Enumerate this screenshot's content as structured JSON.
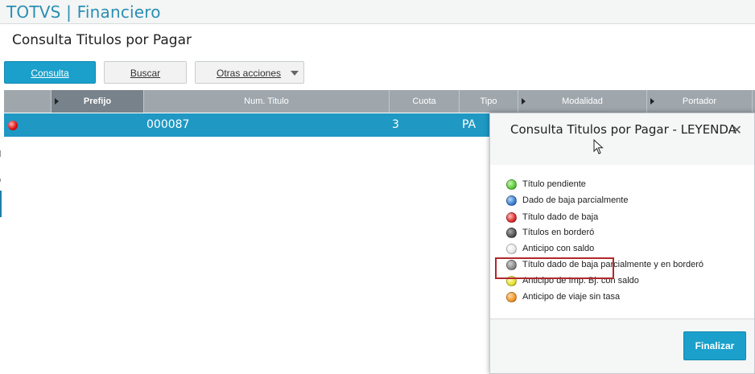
{
  "header": {
    "app_title": "TOTVS | Financiero"
  },
  "page": {
    "title": "Consulta Titulos por Pagar"
  },
  "toolbar": {
    "consulta_label": "Consulta",
    "buscar_label": "Buscar",
    "otras_label": "Otras acciones"
  },
  "grid": {
    "columns": [
      "Prefijo",
      "Num. Titulo",
      "Cuota",
      "Tipo",
      "Modalidad",
      "Portador"
    ],
    "rows": [
      {
        "status": "red",
        "prefijo": "",
        "num_titulo": "000087",
        "cuota": "3",
        "tipo": "PA"
      }
    ]
  },
  "dialog": {
    "title": "Consulta Titulos por Pagar - LEYENDA",
    "close_icon": "close-icon",
    "legend": [
      {
        "label": "Título pendiente",
        "color": "#5fc93b"
      },
      {
        "label": "Dado de baja parcialmente",
        "color": "#3d7fd0"
      },
      {
        "label": "Título dado de baja",
        "color": "#e03030"
      },
      {
        "label": "Títulos en borderó",
        "color": "#555555"
      },
      {
        "label": "Anticipo con saldo",
        "color": "#e8e8e8"
      },
      {
        "label": "Título dado de baja parcialmente y en borderó",
        "color": "#8a8a8a"
      },
      {
        "label": "Anticipo de Imp. Bj. con saldo",
        "color": "#e6e02e"
      },
      {
        "label": "Anticipo de viaje sin tasa",
        "color": "#f29a2e"
      }
    ],
    "finalizar_label": "Finalizar"
  }
}
